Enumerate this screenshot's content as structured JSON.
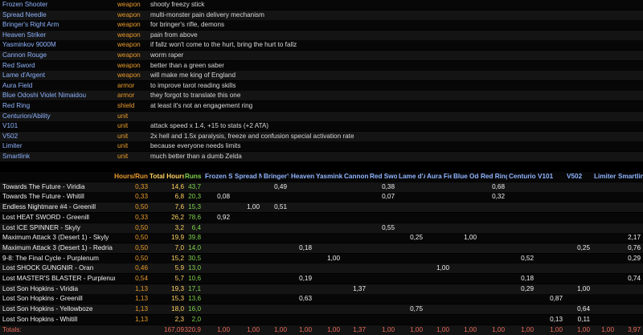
{
  "items": [
    {
      "name": "Frozen Shooter",
      "type": "weapon",
      "desc": "shooty freezy stick"
    },
    {
      "name": "Spread Needle",
      "type": "weapon",
      "desc": "multi-monster pain delivery mechanism"
    },
    {
      "name": "Bringer's Right Arm",
      "type": "weapon",
      "desc": "for bringer's rifle, demons"
    },
    {
      "name": "Heaven Striker",
      "type": "weapon",
      "desc": "pain from above"
    },
    {
      "name": "Yasminkov 9000M",
      "type": "weapon",
      "desc": "if fallz won't come to the hurt, bring the hurt to fallz"
    },
    {
      "name": "Cannon Rouge",
      "type": "weapon",
      "desc": "worm raper"
    },
    {
      "name": "Red Sword",
      "type": "weapon",
      "desc": "better than a green saber"
    },
    {
      "name": "Lame d'Argent",
      "type": "weapon",
      "desc": "will make me king of England"
    },
    {
      "name": "Aura Field",
      "type": "armor",
      "desc": "to improve tarot reading skills"
    },
    {
      "name": "Blue Odoshi Violet Nimaidou",
      "type": "armor",
      "desc": "they forgot to translate this one"
    },
    {
      "name": "Red Ring",
      "type": "shield",
      "desc": "at least it's not an engagement ring"
    },
    {
      "name": "Centurion/Ability",
      "type": "unit",
      "desc": ""
    },
    {
      "name": "V101",
      "type": "unit",
      "desc": "attack speed x 1.4, +15 to stats (+2 ATA)"
    },
    {
      "name": "V502",
      "type": "unit",
      "desc": "2x hell and 1.5x paralysis, freeze and confusion special activation rate"
    },
    {
      "name": "Limiter",
      "type": "unit",
      "desc": "because everyone needs limits"
    },
    {
      "name": "Smartlink",
      "type": "unit",
      "desc": "much better than a dumb Zelda"
    }
  ],
  "table": {
    "headers": {
      "hours_run": "Hours/Run",
      "total_hours": "Total Hours",
      "runs": "Runs",
      "items": [
        "Frozen S",
        "Spread N",
        "Bringer's",
        "Heaven S",
        "Yasmink",
        "Cannon R",
        "Red Swo",
        "Lame d'A",
        "Aura Fiel",
        "Blue Odo",
        "Red Ring",
        "Centurior",
        "V101",
        "V502",
        "Limiter",
        "Smartlink"
      ]
    },
    "rows": [
      {
        "name": "Towards The Future - Viridia",
        "hpr": "0,33",
        "tot": "14,6",
        "runs": "43,7",
        "vals": [
          "",
          "",
          "0,49",
          "",
          "",
          "",
          "0,38",
          "",
          "",
          "",
          "0,68",
          "",
          "",
          "",
          "",
          ""
        ]
      },
      {
        "name": "Towards The Future - Whitill",
        "hpr": "0,33",
        "tot": "6,8",
        "runs": "20,3",
        "vals": [
          "0,08",
          "",
          "",
          "",
          "",
          "",
          "0,07",
          "",
          "",
          "",
          "0,32",
          "",
          "",
          "",
          "",
          ""
        ]
      },
      {
        "name": "Endless Nightmare #4 - Greenill",
        "hpr": "0,50",
        "tot": "7,6",
        "runs": "15,3",
        "vals": [
          "",
          "1,00",
          "0,51",
          "",
          "",
          "",
          "",
          "",
          "",
          "",
          "",
          "",
          "",
          "",
          "",
          ""
        ]
      },
      {
        "name": "Lost HEAT SWORD - Greenill",
        "hpr": "0,33",
        "tot": "26,2",
        "runs": "78,6",
        "vals": [
          "0,92",
          "",
          "",
          "",
          "",
          "",
          "",
          "",
          "",
          "",
          "",
          "",
          "",
          "",
          "",
          ""
        ]
      },
      {
        "name": "Lost ICE SPINNER - Skyly",
        "hpr": "0,50",
        "tot": "3,2",
        "runs": "6,4",
        "vals": [
          "",
          "",
          "",
          "",
          "",
          "",
          "0,55",
          "",
          "",
          "",
          "",
          "",
          "",
          "",
          "",
          ""
        ]
      },
      {
        "name": "Maximum Attack 3 (Desert 1) - Skyly",
        "hpr": "0,50",
        "tot": "19,9",
        "runs": "39,8",
        "vals": [
          "",
          "",
          "",
          "",
          "",
          "",
          "",
          "0,25",
          "",
          "1,00",
          "",
          "",
          "",
          "",
          "",
          "2,17"
        ]
      },
      {
        "name": "Maximum Attack 3 (Desert 1) - Redria",
        "hpr": "0,50",
        "tot": "7,0",
        "runs": "14,0",
        "vals": [
          "",
          "",
          "",
          "0,18",
          "",
          "",
          "",
          "",
          "",
          "",
          "",
          "",
          "",
          "0,25",
          "",
          "0,76"
        ]
      },
      {
        "name": "9-8: The Final Cycle - Purplenum",
        "hpr": "0,50",
        "tot": "15,2",
        "runs": "30,5",
        "vals": [
          "",
          "",
          "",
          "",
          "1,00",
          "",
          "",
          "",
          "",
          "",
          "",
          "0,52",
          "",
          "",
          "",
          "0,29"
        ]
      },
      {
        "name": "Lost SHOCK GUNGNIR - Oran",
        "hpr": "0,46",
        "tot": "5,9",
        "runs": "13,0",
        "vals": [
          "",
          "",
          "",
          "",
          "",
          "",
          "",
          "",
          "1,00",
          "",
          "",
          "",
          "",
          "",
          "",
          ""
        ]
      },
      {
        "name": "Lost MASTER'S BLASTER - Purplenum",
        "hpr": "0,54",
        "tot": "5,7",
        "runs": "10,6",
        "vals": [
          "",
          "",
          "",
          "0,19",
          "",
          "",
          "",
          "",
          "",
          "",
          "",
          "0,18",
          "",
          "",
          "",
          "0,74"
        ]
      },
      {
        "name": "Lost Son Hopkins - Viridia",
        "hpr": "1,13",
        "tot": "19,3",
        "runs": "17,1",
        "vals": [
          "",
          "",
          "",
          "",
          "",
          "1,37",
          "",
          "",
          "",
          "",
          "",
          "0,29",
          "",
          "1,00",
          "",
          ""
        ]
      },
      {
        "name": "Lost Son Hopkins - Greenill",
        "hpr": "1,13",
        "tot": "15,3",
        "runs": "13,6",
        "vals": [
          "",
          "",
          "",
          "0,63",
          "",
          "",
          "",
          "",
          "",
          "",
          "",
          "",
          "0,87",
          "",
          "",
          ""
        ]
      },
      {
        "name": "Lost Son Hopkins - Yellowboze",
        "hpr": "1,13",
        "tot": "18,0",
        "runs": "16,0",
        "vals": [
          "",
          "",
          "",
          "",
          "",
          "",
          "",
          "0,75",
          "",
          "",
          "",
          "",
          "",
          "0,64",
          "",
          ""
        ]
      },
      {
        "name": "Lost Son Hopkins - Whitill",
        "hpr": "1,13",
        "tot": "2,3",
        "runs": "2,0",
        "vals": [
          "",
          "",
          "",
          "",
          "",
          "",
          "",
          "",
          "",
          "",
          "",
          "",
          "0,13",
          "0,11",
          "",
          ""
        ]
      }
    ],
    "totals": {
      "label": "Totals:",
      "hpr": "",
      "tot": "167,09",
      "runs": "320,9",
      "vals": [
        "1,00",
        "1,00",
        "1,00",
        "1,00",
        "1,00",
        "1,37",
        "1,00",
        "1,00",
        "1,00",
        "1,00",
        "1,00",
        "1,00",
        "1,00",
        "1,00",
        "1,00",
        "3,97"
      ]
    }
  }
}
